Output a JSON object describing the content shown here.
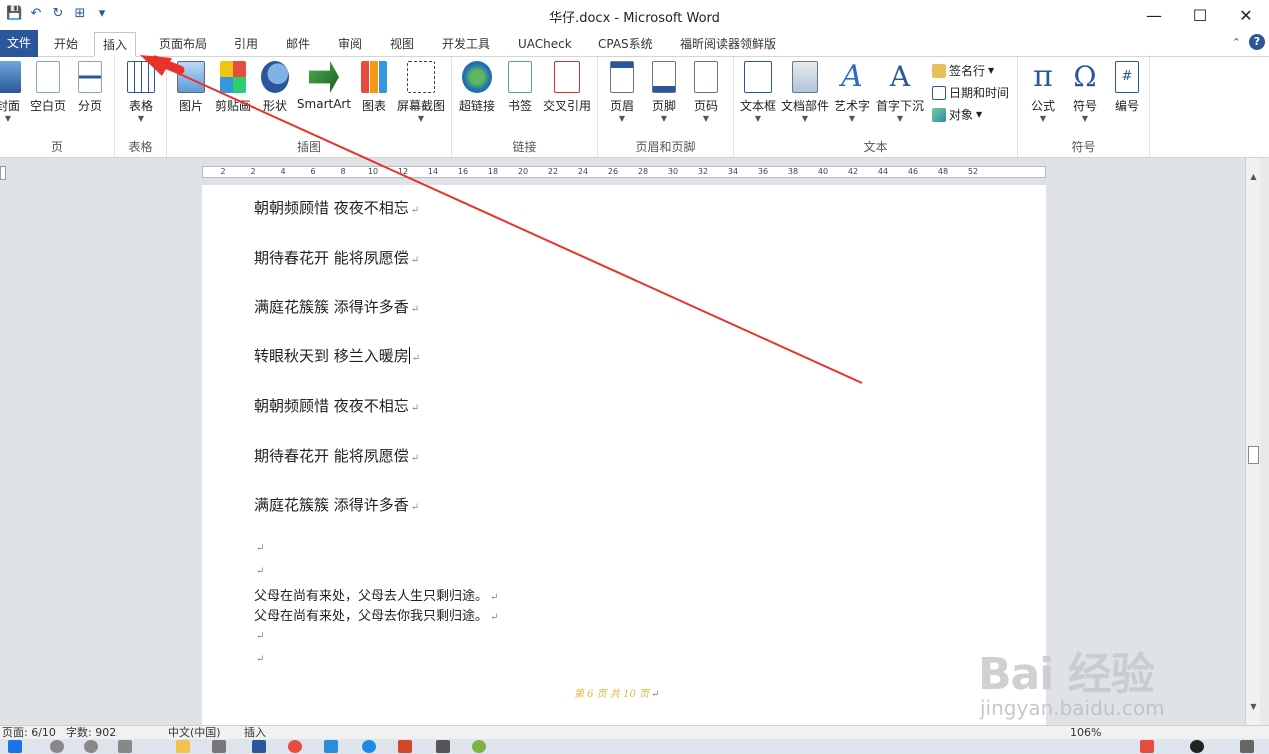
{
  "window": {
    "title": "华仔.docx - Microsoft Word",
    "controls": {
      "minimize": "—",
      "maximize": "☐",
      "close": "✕"
    }
  },
  "quick_access": {
    "save": "💾",
    "undo": "↶",
    "redo": "↻",
    "custom": "⊞",
    "more": "▾"
  },
  "tabs": [
    {
      "label": "文件"
    },
    {
      "label": "开始"
    },
    {
      "label": "插入"
    },
    {
      "label": "页面布局"
    },
    {
      "label": "引用"
    },
    {
      "label": "邮件"
    },
    {
      "label": "审阅"
    },
    {
      "label": "视图"
    },
    {
      "label": "开发工具"
    },
    {
      "label": "UACheck"
    },
    {
      "label": "CPAS系统"
    },
    {
      "label": "福昕阅读器领鲜版"
    }
  ],
  "tab_help": {
    "collapse": "⌃",
    "help": "?"
  },
  "ribbon": {
    "groups": {
      "pages": {
        "label": "页",
        "buttons": [
          "封面",
          "空白页",
          "分页"
        ]
      },
      "tables": {
        "label": "表格",
        "buttons": [
          "表格"
        ]
      },
      "illustrations": {
        "label": "插图",
        "buttons": [
          "图片",
          "剪贴画",
          "形状",
          "SmartArt",
          "图表",
          "屏幕截图"
        ]
      },
      "links": {
        "label": "链接",
        "buttons": [
          "超链接",
          "书签",
          "交叉引用"
        ]
      },
      "header_footer": {
        "label": "页眉和页脚",
        "buttons": [
          "页眉",
          "页脚",
          "页码"
        ]
      },
      "text": {
        "label": "文本",
        "buttons": [
          "文本框",
          "文档部件",
          "艺术字",
          "首字下沉"
        ],
        "small": [
          "签名行",
          "日期和时间",
          "对象"
        ]
      },
      "symbols": {
        "label": "符号",
        "buttons": [
          "公式",
          "符号",
          "编号"
        ]
      }
    }
  },
  "ruler": {
    "ticks": [
      "2",
      "2",
      "4",
      "6",
      "8",
      "10",
      "12",
      "14",
      "16",
      "18",
      "20",
      "22",
      "24",
      "26",
      "28",
      "30",
      "32",
      "34",
      "36",
      "38",
      "40",
      "42",
      "44",
      "46",
      "48",
      "52"
    ]
  },
  "document": {
    "lines": [
      "朝朝频顾惜 夜夜不相忘",
      "期待春花开 能将夙愿偿",
      "满庭花簇簇 添得许多香",
      "转眼秋天到 移兰入暖房",
      "朝朝频顾惜 夜夜不相忘",
      "期待春花开 能将夙愿偿",
      "满庭花簇簇 添得许多香",
      "",
      "",
      "父母在尚有来处，父母去人生只剩归途。",
      "父母在尚有来处，父母去你我只剩归途。",
      "",
      ""
    ],
    "para_mark": "↵",
    "footer_text": "第 6 页  共 10 页",
    "after_footer": "↵"
  },
  "status_bar": {
    "page": "页面: 6/10",
    "words": "字数: 902",
    "language": "中文(中国)",
    "mode": "插入",
    "zoom": "106%"
  },
  "watermark": {
    "brand": "Bai 经验",
    "url": "jingyan.baidu.com"
  },
  "colors": {
    "accent": "#2b579a",
    "arrow": "#e8332a"
  }
}
